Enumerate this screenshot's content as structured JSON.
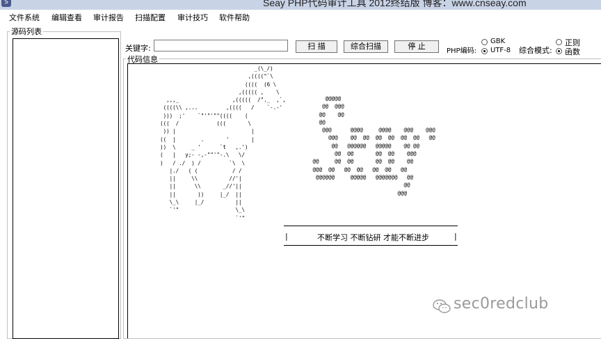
{
  "window": {
    "icon_name": "app-icon",
    "title": "Seay PHP代码审计工具 2012终结版  博客：www.cnseay.com"
  },
  "menu": [
    {
      "label": "文件系统"
    },
    {
      "label": "编辑查看"
    },
    {
      "label": "审计报告"
    },
    {
      "label": "扫描配置"
    },
    {
      "label": "审计技巧"
    },
    {
      "label": "软件帮助"
    }
  ],
  "left_panel": {
    "title": "源码列表"
  },
  "search": {
    "keyword_label": "关键字:",
    "keyword_value": "",
    "scan_button": "扫 描",
    "full_scan_button": "综合扫描",
    "stop_button": "停 止"
  },
  "encoding": {
    "label": "PHP编码:",
    "options": [
      {
        "label": "GBK",
        "selected": false
      },
      {
        "label": "UTF-8",
        "selected": true
      }
    ]
  },
  "mode": {
    "label": "综合模式:",
    "options": [
      {
        "label": "正则",
        "selected": false
      },
      {
        "label": "函数",
        "selected": true
      }
    ]
  },
  "code_panel": {
    "title": "代码信息",
    "horse_art": "                                    _(\\_/)\n                                  ,((((^`\\\n                                 ((((  (6 \\\n                               ,((((( ,    \\\n        ,,,_                 ,(((((  /\"._  ,`,\n       ((((\\\\ ,...         ,((((   /    `-.-'\n       )))  ;'    `\"'\"'\"\"((((    (\n      (((  /            (((       \\\n       )) |                        |\n      ((  |        .       '       |\n      ))  \\     _ '      `t   ,.')\n      (   |   y;- -,-\"\"'\"-.\\   \\/\n      )   / ./  ) /         `\\  \\\n         |./   ( (           / /\n         ||     \\\\          //'|\n         ||      \\\\       _//'||\n         ||       ))     |_/  ||\n         \\_\\     |_/          ||\n         `'\"                  \\_\\\n                              `'\"",
    "logo_art": "       @@@@@\n      @@  @@@\n     @@    @@\n     @@\n      @@@      @@@@     @@@@    @@@    @@@\n        @@@    @@  @@  @@  @@  @@  @@   @@\n         @@   @@@@@@   @@@@@    @@ @@\n          @@  @@       @@  @@    @@@\n   @@     @@  @@       @@  @@    @@\n   @@@  @@   @@  @@   @@  @@   @@\n    @@@@@@     @@@@@   @@@@@@@   @@\n                                @@\n                              @@@",
    "slogan": "不断学习 不断钻研 才能不断进步",
    "slogan_bar": "|"
  },
  "watermark": {
    "icon_name": "wechat-icon",
    "text": "sec0redclub"
  }
}
